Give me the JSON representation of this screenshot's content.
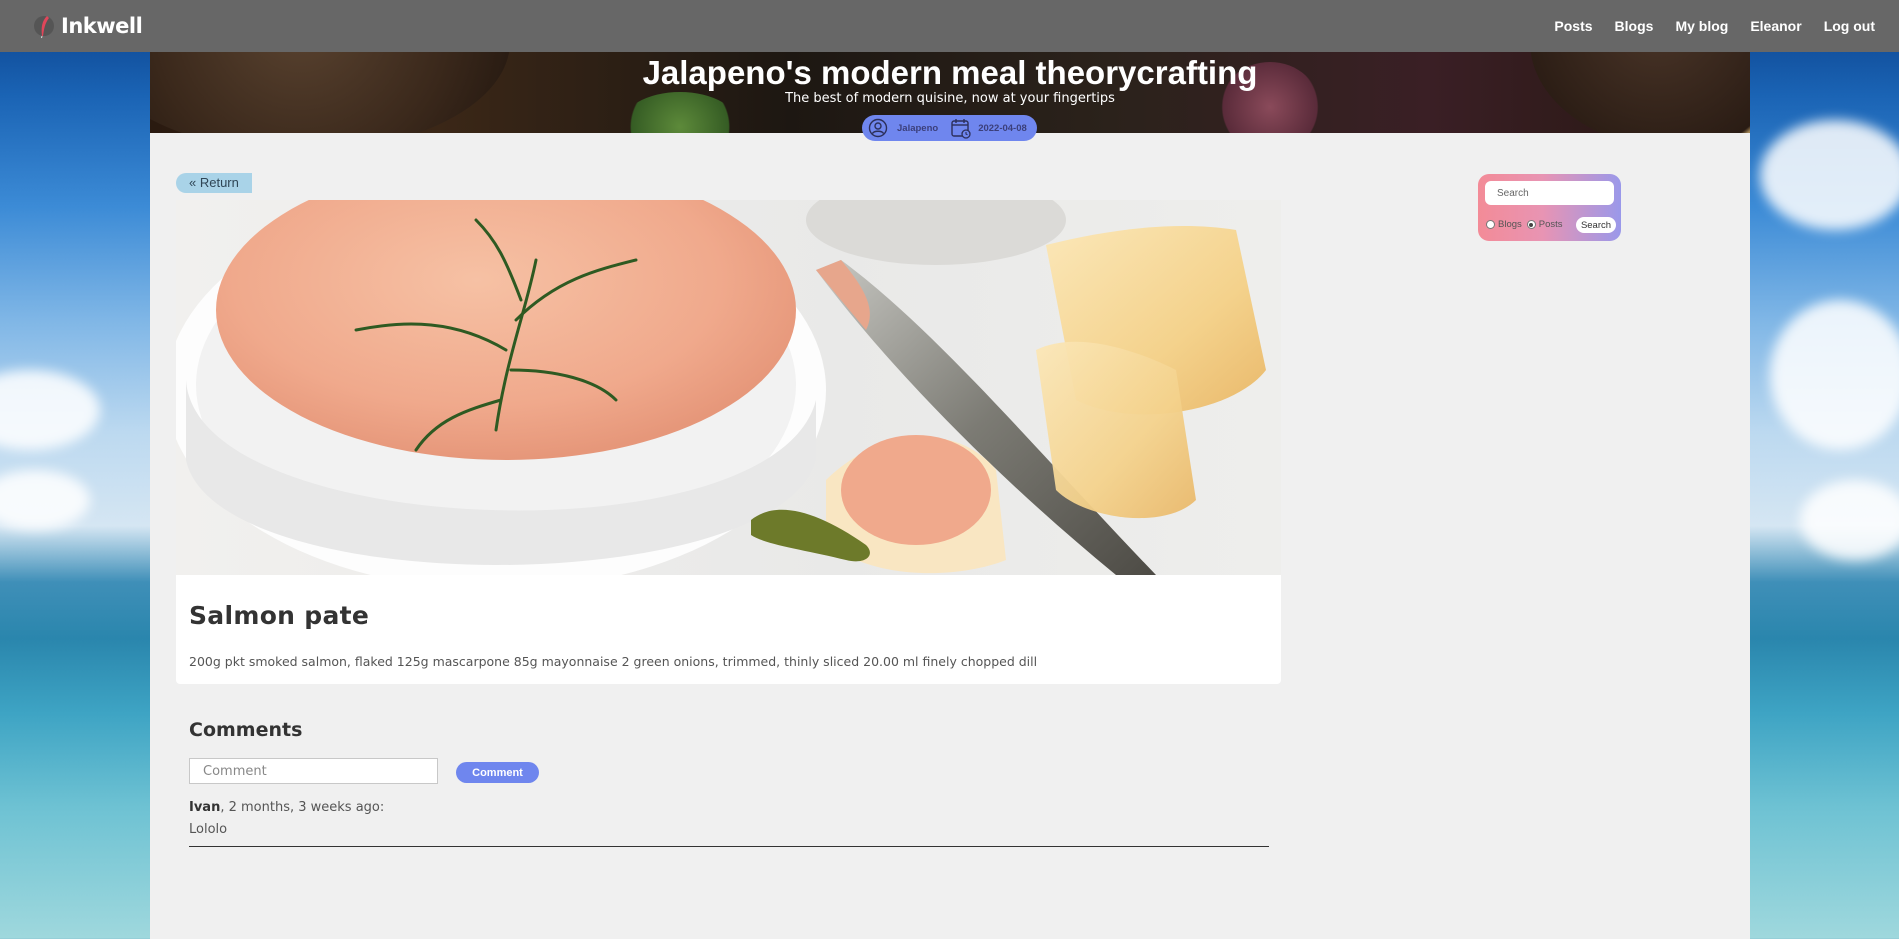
{
  "brand": {
    "name": "Inkwell"
  },
  "nav": {
    "links": [
      "Posts",
      "Blogs",
      "My blog",
      "Eleanor",
      "Log out"
    ]
  },
  "blog": {
    "title": "Jalapeno's modern meal theorycrafting",
    "subtitle": "The best of modern quisine, now at your fingertips",
    "author": "Jalapeno",
    "date": "2022-04-08"
  },
  "post": {
    "return_label": "« Return",
    "title": "Salmon pate",
    "body": "200g pkt smoked salmon, flaked 125g mascarpone 85g mayonnaise 2 green onions, trimmed, thinly sliced 20.00 ml finely chopped dill"
  },
  "comments": {
    "heading": "Comments",
    "input_placeholder": "Comment",
    "submit_label": "Comment",
    "items": [
      {
        "author": "Ivan",
        "when": ", 2 months, 3 weeks ago:",
        "text": "Lololo"
      }
    ]
  },
  "search": {
    "placeholder": "Search",
    "options": [
      "Blogs",
      "Posts"
    ],
    "selected": "Posts",
    "button_label": "Search"
  },
  "colors": {
    "nav_bg": "#676767",
    "accent": "#6f86ee",
    "return_bg": "#a9d3e8",
    "page_bg": "#f0f0f0"
  }
}
